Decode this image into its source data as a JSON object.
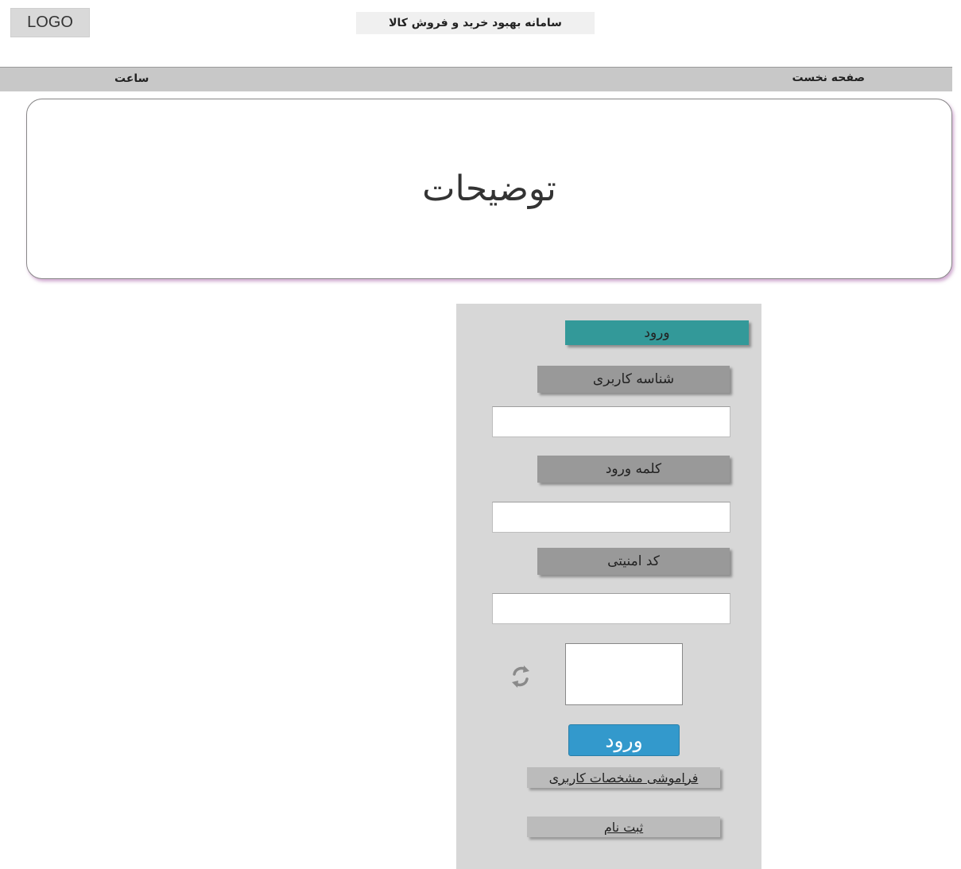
{
  "header": {
    "logo_text": "LOGO",
    "site_title": "سامانه بهبود خرید و فروش کالا"
  },
  "navbar": {
    "home_label": "صفحه نخست",
    "clock_label": "ساعت"
  },
  "description": {
    "text": "توضیحات"
  },
  "login": {
    "header_label": "ورود",
    "username_label": "شناسه کاربری",
    "username_value": "",
    "password_label": "کلمه ورود",
    "password_value": "",
    "captcha_label": "کد امنیتی",
    "captcha_value": "",
    "refresh_icon": "refresh-icon",
    "submit_label": "ورود",
    "forgot_link": "فراموشی مشخصات کاربری",
    "register_link": "ثبت نام"
  },
  "colors": {
    "panel_header": "#339999",
    "submit_button": "#3399cc",
    "label_bg": "#999999",
    "panel_bg": "#d7d7d7"
  }
}
